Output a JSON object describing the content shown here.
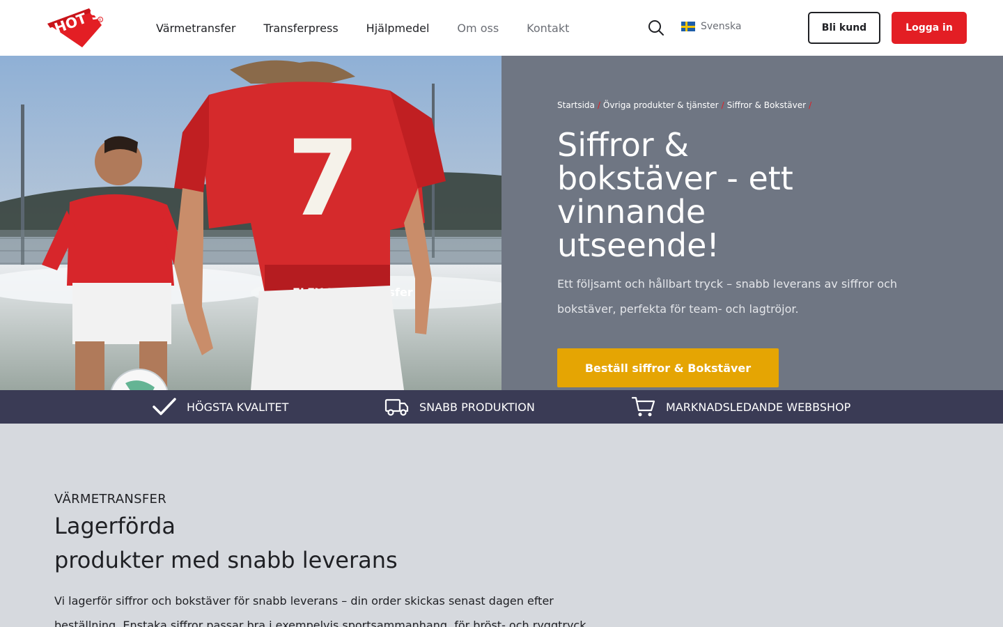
{
  "header": {
    "logo_text": "HOT SCREEN",
    "nav": [
      "Värmetransfer",
      "Transferpress",
      "Hjälpmedel",
      "Om oss",
      "Kontakt"
    ],
    "language": "Svenska",
    "become_customer": "Bli kund",
    "login": "Logga in"
  },
  "hero": {
    "image_text": {
      "shirt_number": "7",
      "shirt_brand": "FLEX Heat Transfer"
    },
    "breadcrumb": [
      "Startsida",
      "Övriga produkter & tjänster",
      "Siffror & Bokstäver"
    ],
    "breadcrumb_separator": "/",
    "title": "Siffror & bokstäver - ett vinnande utseende!",
    "subtitle": "Ett följsamt och hållbart tryck – snabb leverans av siffror och bokstäver, perfekta för team- och lagtröjor.",
    "cta": "Beställ siffror & Bokstäver"
  },
  "features": [
    "HÖGSTA KVALITET",
    "SNABB PRODUKTION",
    "MARKNADSLEDANDE WEBBSHOP"
  ],
  "section": {
    "kicker": "VÄRMETRANSFER",
    "title_line1": "Lagerförda",
    "title_line2": "produkter med snabb leverans",
    "body": "Vi lagerför siffror och bokstäver för snabb leverans – din order skickas senast dagen efter beställning. Enstaka siffror passar bra i exempelvis sportsammanhang, för bröst- och ryggtryck"
  },
  "colors": {
    "brand_red": "#e31e24",
    "cta_yellow": "#e5a503",
    "strip_navy": "#3a3b55",
    "hero_panel": "#6f7683"
  }
}
